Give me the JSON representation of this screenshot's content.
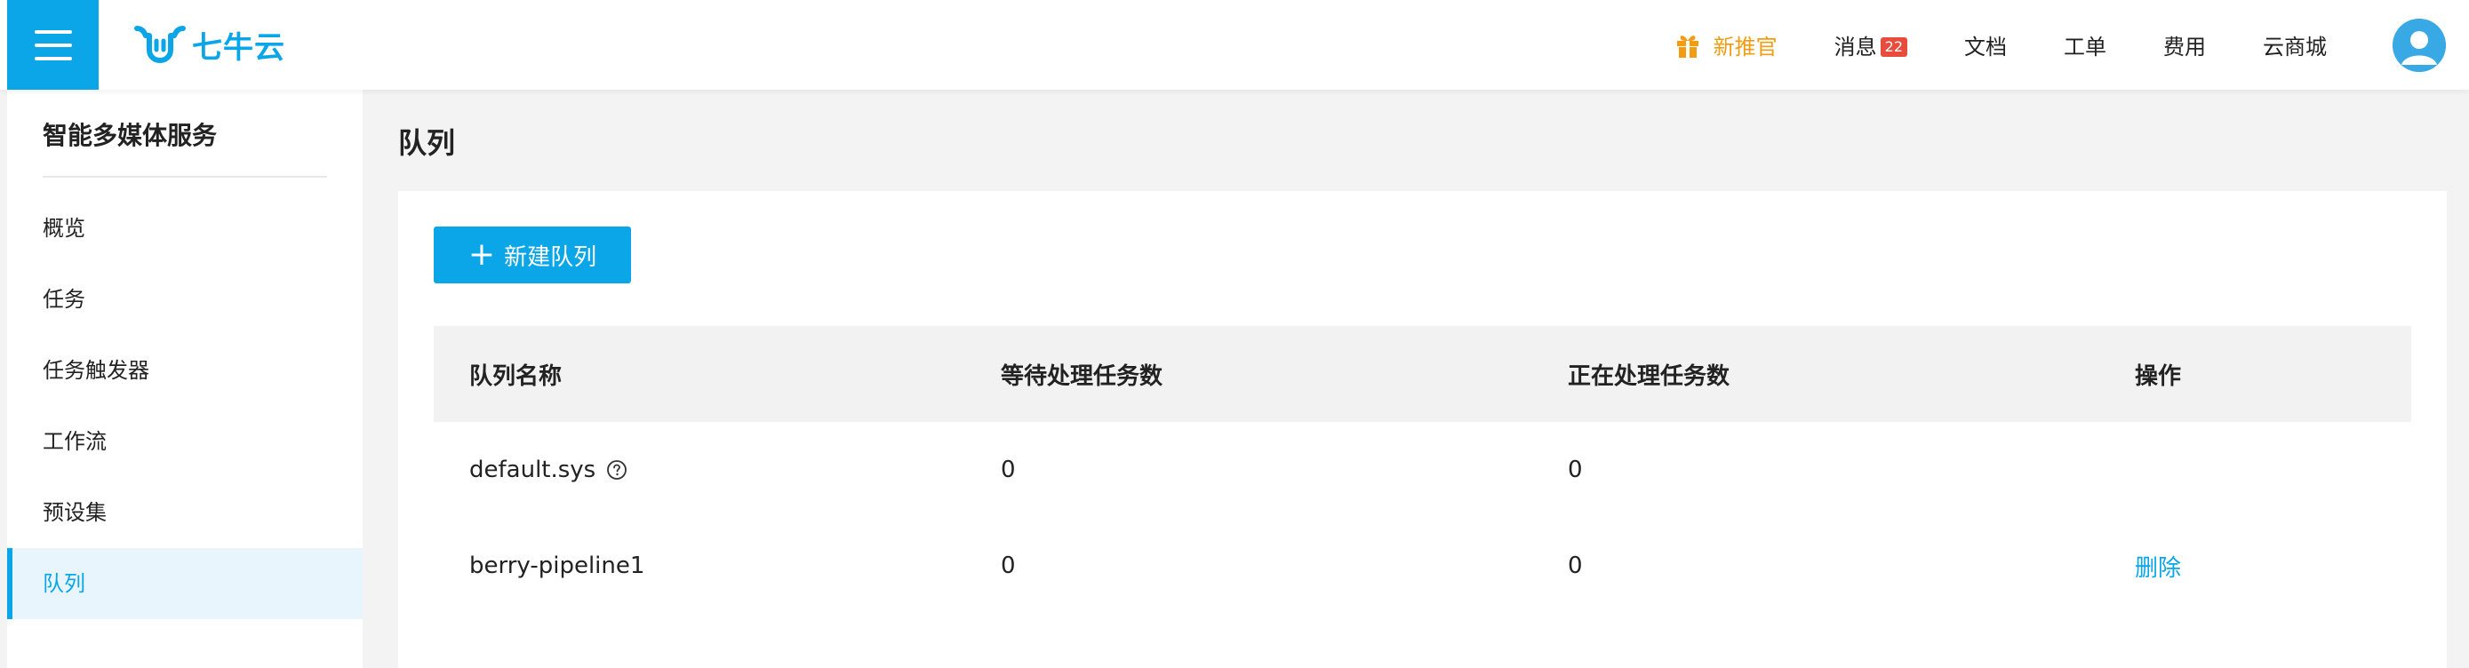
{
  "topbar": {
    "logo_text": "七牛云",
    "nav": {
      "promo": "新推官",
      "messages": "消息",
      "messages_count": "22",
      "docs": "文档",
      "ticket": "工单",
      "billing": "费用",
      "store": "云商城"
    }
  },
  "sidebar": {
    "title": "智能多媒体服务",
    "items": [
      {
        "label": "概览"
      },
      {
        "label": "任务"
      },
      {
        "label": "任务触发器"
      },
      {
        "label": "工作流"
      },
      {
        "label": "预设集"
      },
      {
        "label": "队列"
      }
    ],
    "active_index": 5
  },
  "main": {
    "title": "队列",
    "new_button": "新建队列",
    "table": {
      "headers": [
        "队列名称",
        "等待处理任务数",
        "正在处理任务数",
        "操作"
      ],
      "rows": [
        {
          "name": "default.sys",
          "waiting": "0",
          "processing": "0",
          "action": ""
        },
        {
          "name": "berry-pipeline1",
          "waiting": "0",
          "processing": "0",
          "action": "删除"
        }
      ]
    }
  },
  "colors": {
    "accent": "#0aa6e8",
    "promo": "#f39c12",
    "badge": "#e84c3d",
    "active_bg": "#e8f5fd"
  }
}
